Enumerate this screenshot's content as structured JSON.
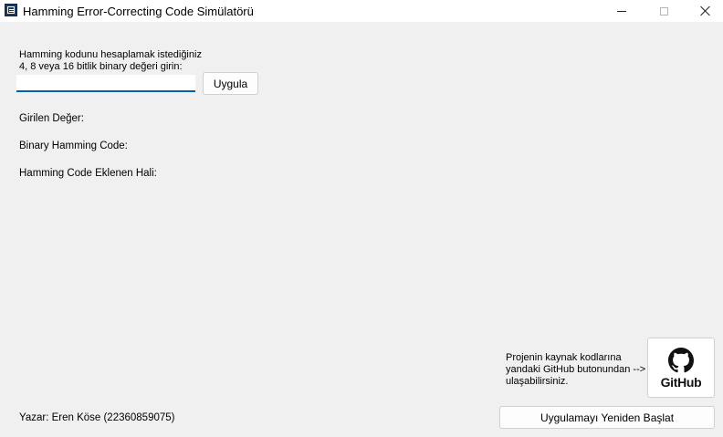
{
  "window": {
    "title": "Hamming Error-Correcting Code Simülatörü",
    "icons": {
      "app": "app-window-icon",
      "minimize": "minimize-icon",
      "maximize": "maximize-icon",
      "close": "close-icon"
    }
  },
  "input_section": {
    "instruction_line1": "Hamming kodunu hesaplamak istediğiniz",
    "instruction_line2": "4, 8 veya 16 bitlik binary değeri girin:",
    "input_value": "",
    "apply_button": "Uygula"
  },
  "results": {
    "entered_value_label": "Girilen Değer:",
    "binary_hamming_label": "Binary Hamming Code:",
    "hamming_added_label": "Hamming Code Eklenen Hali:"
  },
  "github": {
    "note_line1": "Projenin kaynak kodlarına",
    "note_line2": "yandaki GitHub butonundan -->",
    "note_line3": "ulaşabilirsiniz.",
    "button_label": "GitHub",
    "icon": "github-icon"
  },
  "footer": {
    "author": "Yazar: Eren Köse (22360859075)",
    "restart_button": "Uygulamayı Yeniden Başlat"
  }
}
